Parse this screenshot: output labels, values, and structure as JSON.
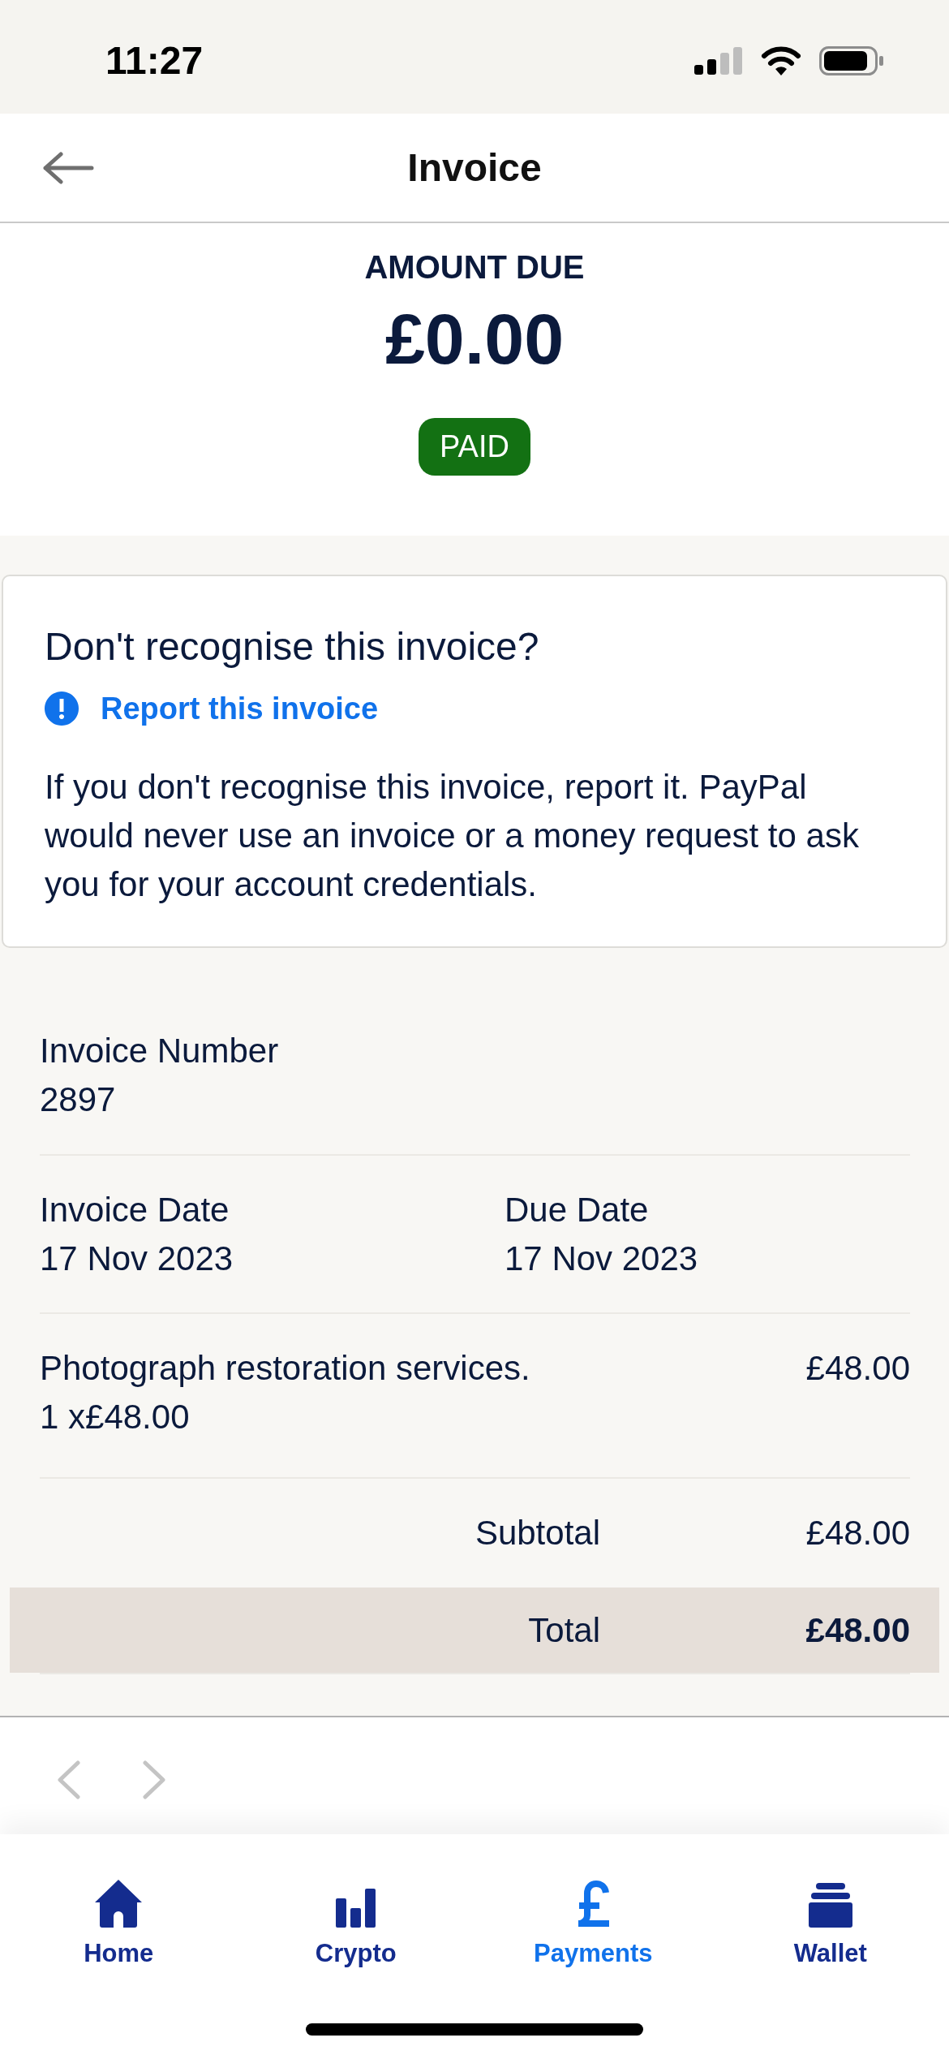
{
  "status_bar": {
    "time": "11:27"
  },
  "header": {
    "title": "Invoice"
  },
  "amount": {
    "label": "AMOUNT DUE",
    "value": "£0.00",
    "status": {
      "kind": "paid",
      "text": "PAID"
    }
  },
  "notice": {
    "title": "Don't recognise this invoice?",
    "link": "Report this invoice",
    "body": "If you don't recognise this invoice, report it. PayPal would never use an invoice or a money request to ask you for your account credentials."
  },
  "details": {
    "invoice_number": {
      "label": "Invoice Number",
      "value": "2897"
    },
    "dates": [
      {
        "label": "Invoice Date",
        "value": "17 Nov 2023"
      },
      {
        "label": "Due Date",
        "value": "17 Nov 2023"
      }
    ],
    "items": [
      {
        "description": "Photograph restoration services.",
        "quantity": "1 x£48.00",
        "amount": "£48.00"
      }
    ],
    "subtotal": {
      "label": "Subtotal",
      "value": "£48.00"
    },
    "total": {
      "label": "Total",
      "value": "£48.00"
    }
  },
  "pager": {
    "previous": {
      "disabled": true
    },
    "next": {
      "disabled": true
    }
  },
  "tab_bar": {
    "tabs": [
      {
        "kind": "home",
        "label": "Home",
        "selected": false
      },
      {
        "kind": "crypto",
        "label": "Crypto",
        "selected": false
      },
      {
        "kind": "payments",
        "label": "Payments",
        "selected": true
      },
      {
        "kind": "wallet",
        "label": "Wallet",
        "selected": false
      }
    ]
  }
}
